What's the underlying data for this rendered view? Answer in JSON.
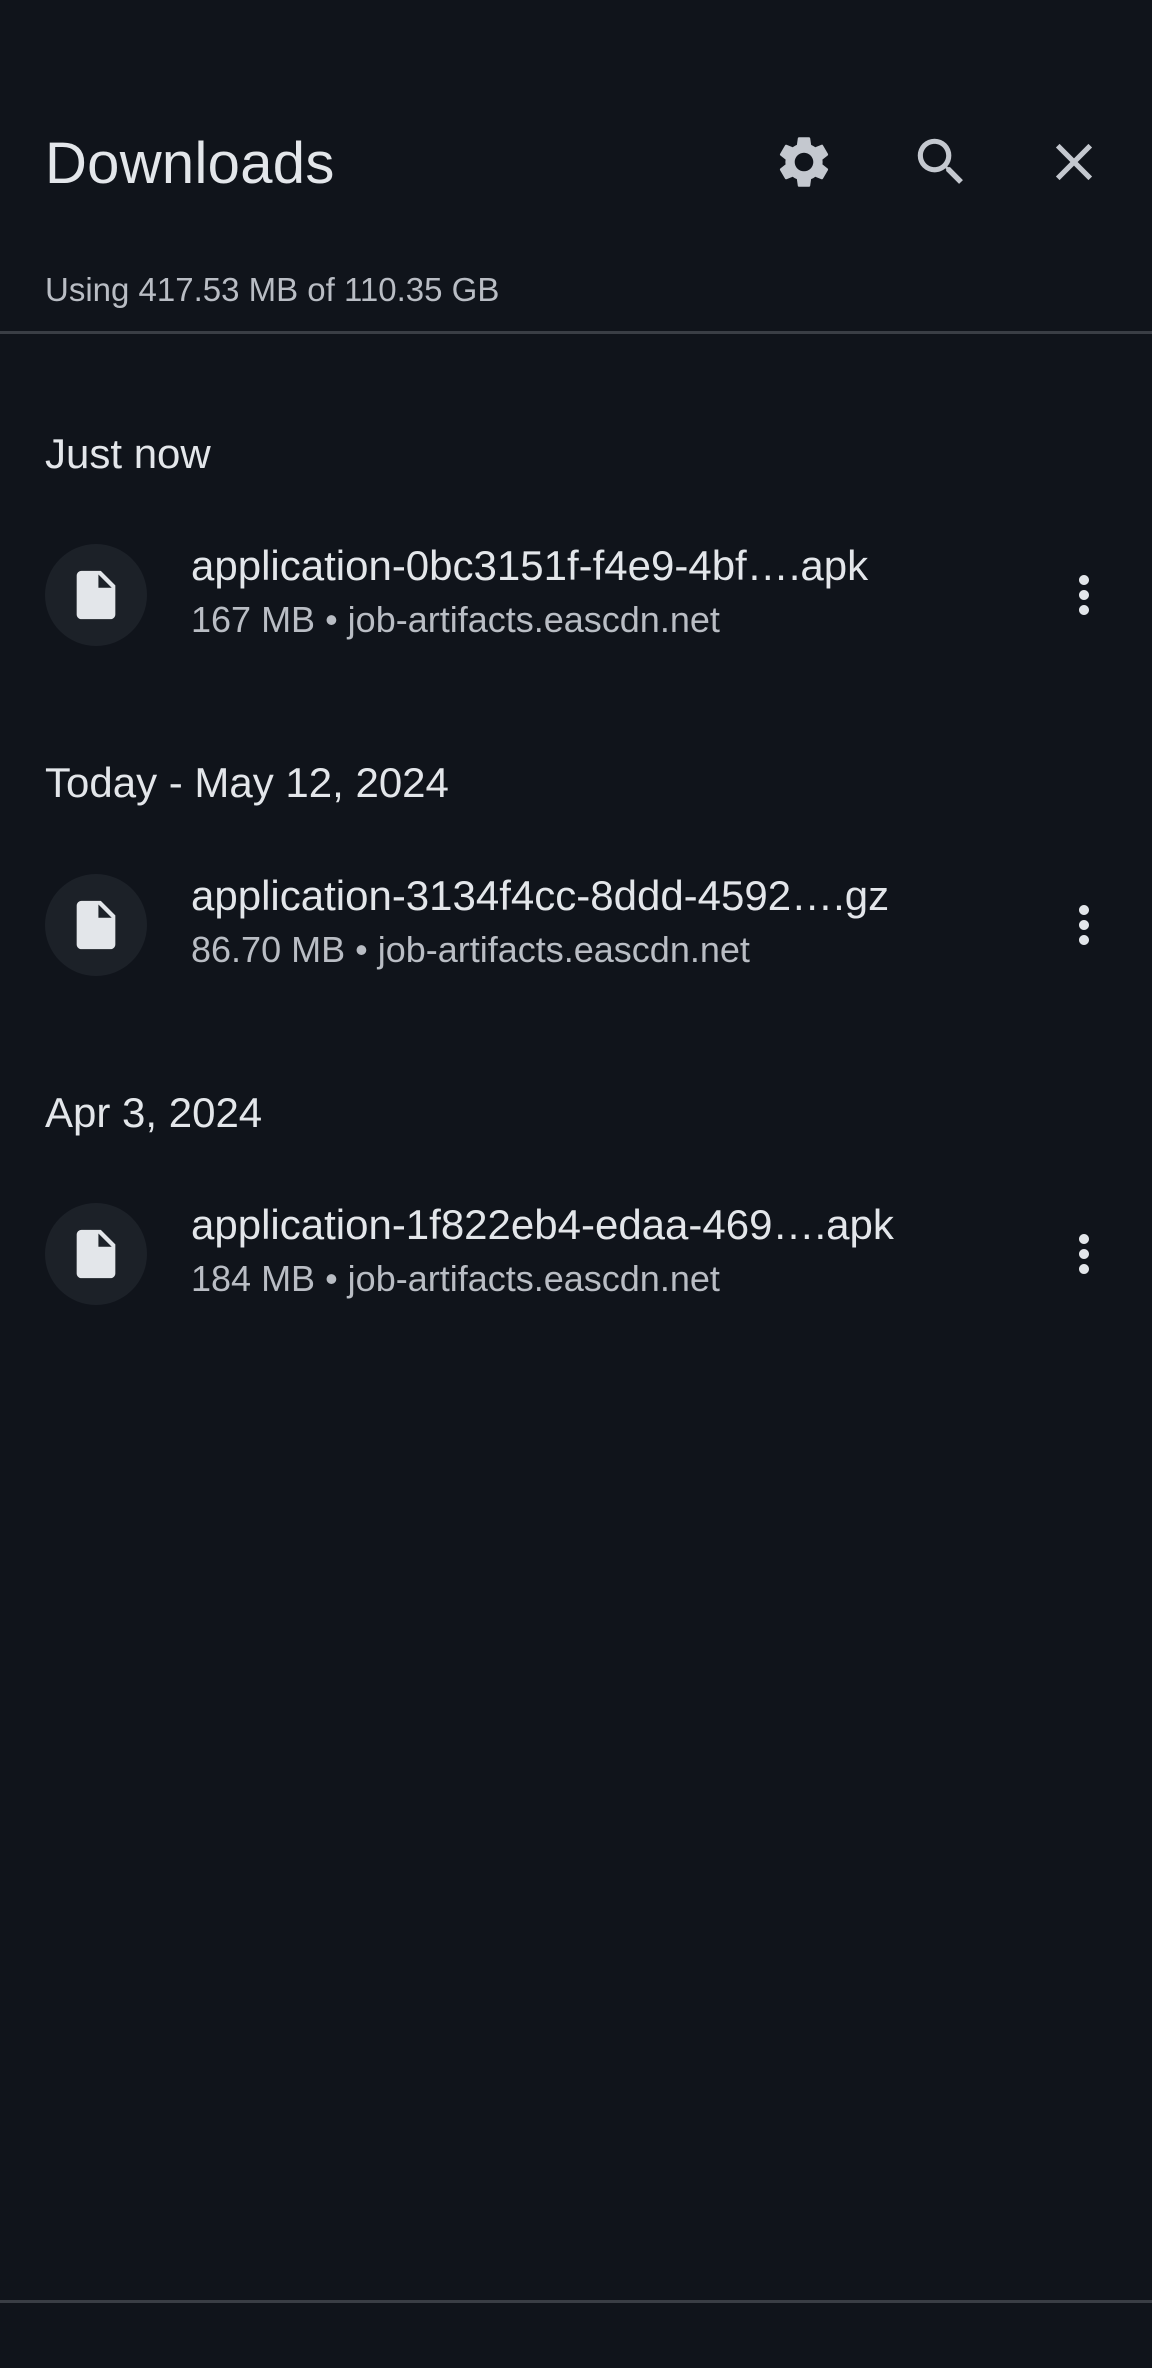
{
  "header": {
    "title": "Downloads",
    "settings_icon": "gear-icon",
    "search_icon": "search-icon",
    "close_icon": "close-icon"
  },
  "storage": {
    "text": "Using 417.53 MB of 110.35 GB"
  },
  "sections": [
    {
      "label": "Just now",
      "items": [
        {
          "name": "application-0bc3151f-f4e9-4bf….apk",
          "meta": "167 MB • job-artifacts.eascdn.net"
        }
      ]
    },
    {
      "label": "Today - May 12, 2024",
      "items": [
        {
          "name": "application-3134f4cc-8ddd-4592….gz",
          "meta": "86.70 MB • job-artifacts.eascdn.net"
        }
      ]
    },
    {
      "label": "Apr 3, 2024",
      "items": [
        {
          "name": "application-1f822eb4-edaa-469….apk",
          "meta": "184 MB • job-artifacts.eascdn.net"
        }
      ]
    }
  ],
  "colors": {
    "background": "#10141b",
    "text_primary": "#e3e6ea",
    "text_secondary": "#b9bdc4",
    "icon_circle": "#1c2128",
    "divider": "#3a3e45"
  }
}
